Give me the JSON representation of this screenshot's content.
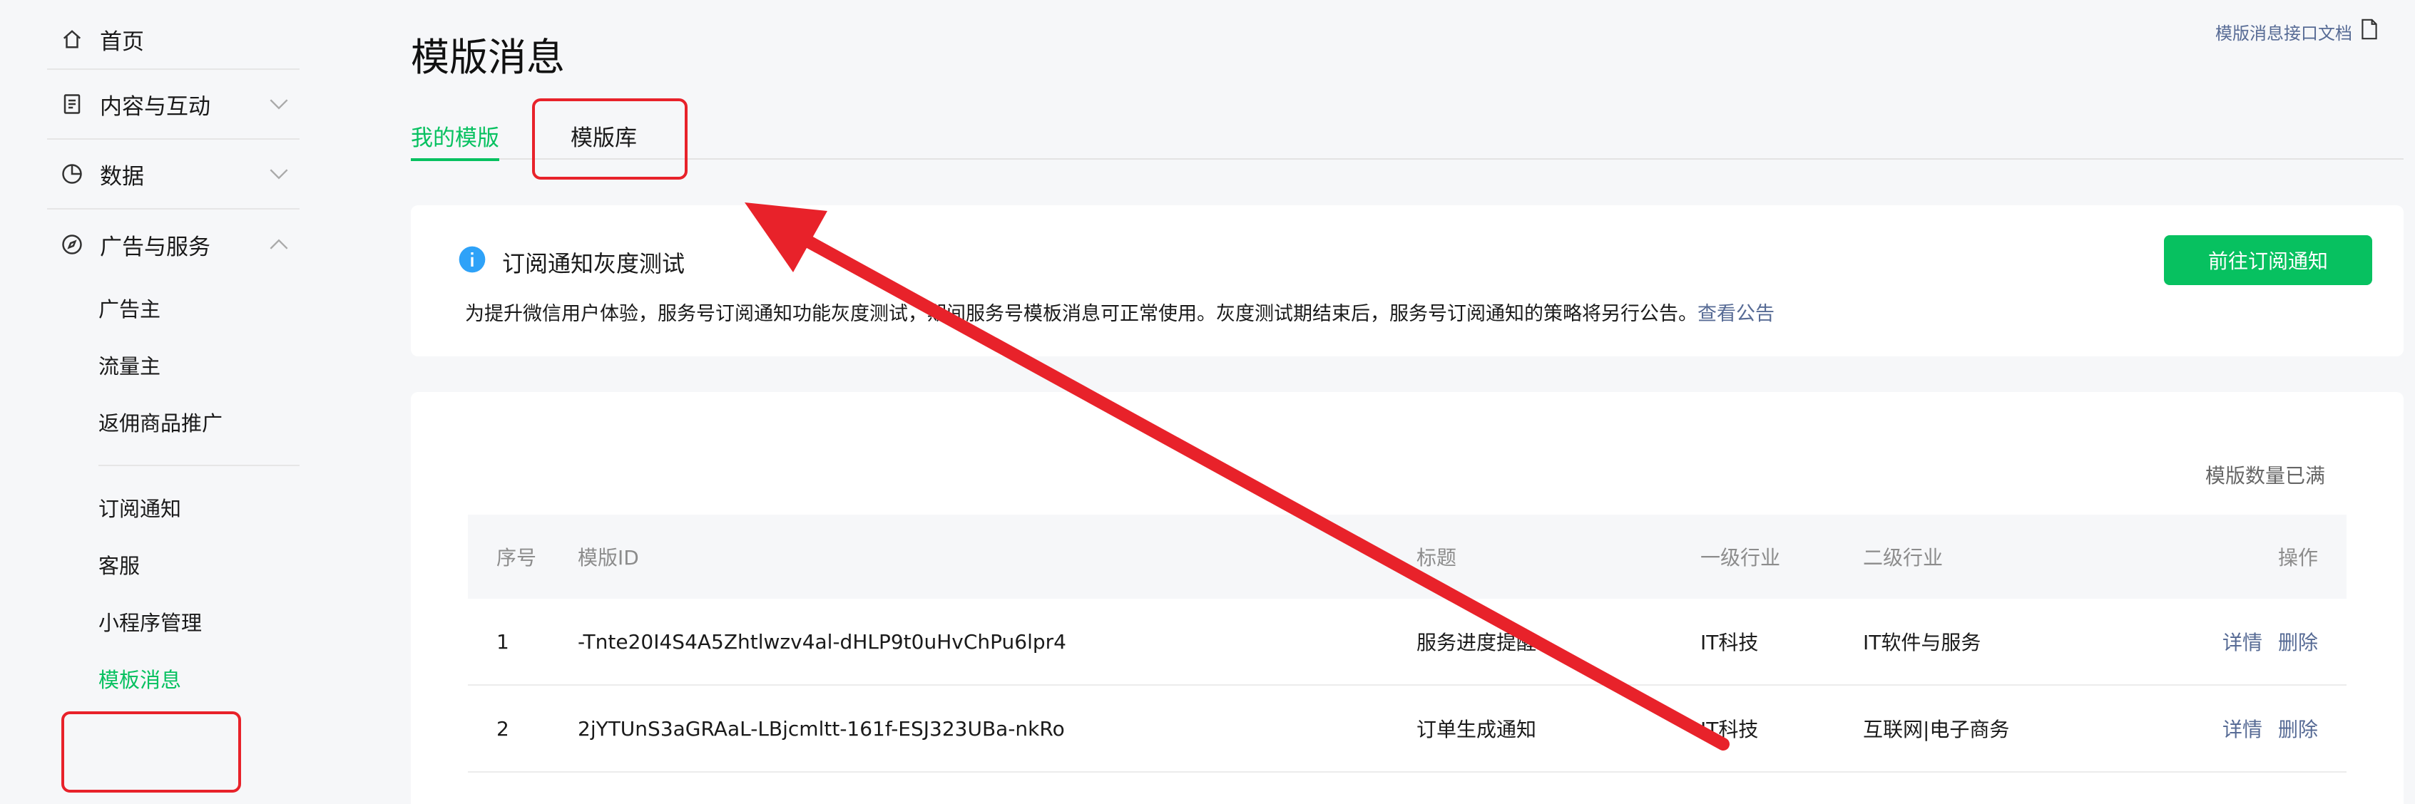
{
  "sidebar": {
    "home_label": "首页",
    "groups": [
      {
        "label": "内容与互动"
      },
      {
        "label": "数据"
      },
      {
        "label": "广告与服务"
      }
    ],
    "sub_items_a": [
      "广告主",
      "流量主",
      "返佣商品推广"
    ],
    "sub_items_b": [
      "订阅通知",
      "客服",
      "小程序管理",
      "模板消息"
    ]
  },
  "page": {
    "title": "模版消息",
    "doc_link": "模版消息接口文档"
  },
  "tabs": [
    "我的模版",
    "模版库"
  ],
  "notice": {
    "title": "订阅通知灰度测试",
    "body_text": "为提升微信用户体验，服务号订阅通知功能灰度测试，期间服务号模板消息可正常使用。灰度测试期结束后，服务号订阅通知的策略将另行公告。",
    "link": "查看公告",
    "button": "前往订阅通知"
  },
  "table": {
    "quota_text": "模版数量已满",
    "headers": [
      "序号",
      "模版ID",
      "标题",
      "一级行业",
      "二级行业",
      "操作"
    ],
    "rows": [
      {
        "no": "1",
        "id": "-Tnte20I4S4A5Zhtlwzv4al-dHLP9t0uHvChPu6lpr4",
        "title": "服务进度提醒",
        "ind1": "IT科技",
        "ind2": "IT软件与服务",
        "op1": "详情",
        "op2": "删除"
      },
      {
        "no": "2",
        "id": "2jYTUnS3aGRAaL-LBjcmltt-161f-ESJ323UBa-nkRo",
        "title": "订单生成通知",
        "ind1": "IT科技",
        "ind2": "互联网|电子商务",
        "op1": "详情",
        "op2": "删除"
      }
    ]
  },
  "colors": {
    "accent_green": "#07c160",
    "link_blue": "#576b95",
    "annotation_red": "#e8222a",
    "info_blue": "#2ea2f8"
  }
}
